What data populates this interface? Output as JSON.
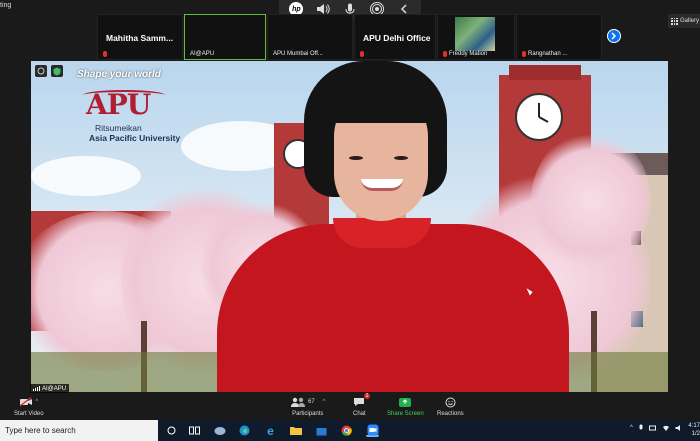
{
  "window": {
    "title_fragment": "ting"
  },
  "hp_toolbar": {
    "icons": [
      "hp-logo",
      "speaker-icon",
      "microphone-icon",
      "broadcast-icon",
      "chevron-left-icon"
    ],
    "hp_text": "hp"
  },
  "thumbnails": [
    {
      "name": "Mahitha Samm...",
      "muted": true,
      "style": "name-only"
    },
    {
      "name": "AI@APU",
      "muted": false,
      "style": "video",
      "active": true
    },
    {
      "name": "APU Mumbai Off...",
      "muted": false,
      "style": "video"
    },
    {
      "name": "APU Delhi Office",
      "muted": true,
      "style": "name-only"
    },
    {
      "name": "Freddy Mation",
      "muted": true,
      "style": "video"
    },
    {
      "name": "Rangnathan ...",
      "muted": true,
      "style": "video"
    }
  ],
  "gallery_button": {
    "label": "Gallery"
  },
  "main_video": {
    "speaker_name": "AI@APU",
    "background": {
      "tagline": "Shape your world",
      "logo": "APU",
      "org_line1": "Ritsumeikan",
      "org_line2": "Asia Pacific University"
    }
  },
  "toolbar": {
    "start_video": "Start Video",
    "participants": "Participants",
    "participant_count": "67",
    "chat": "Chat",
    "chat_badge": "1",
    "share_screen": "Share Screen",
    "reactions": "Reactions"
  },
  "taskbar": {
    "search_placeholder": "Type here to search",
    "time": "4:17",
    "date": "1/2"
  },
  "colors": {
    "zoom_blue": "#0e72ed",
    "share_green": "#21b04b",
    "active_speaker_border": "#5fbf3a",
    "sweater_red": "#c4161f",
    "apu_red": "#b01e32"
  }
}
